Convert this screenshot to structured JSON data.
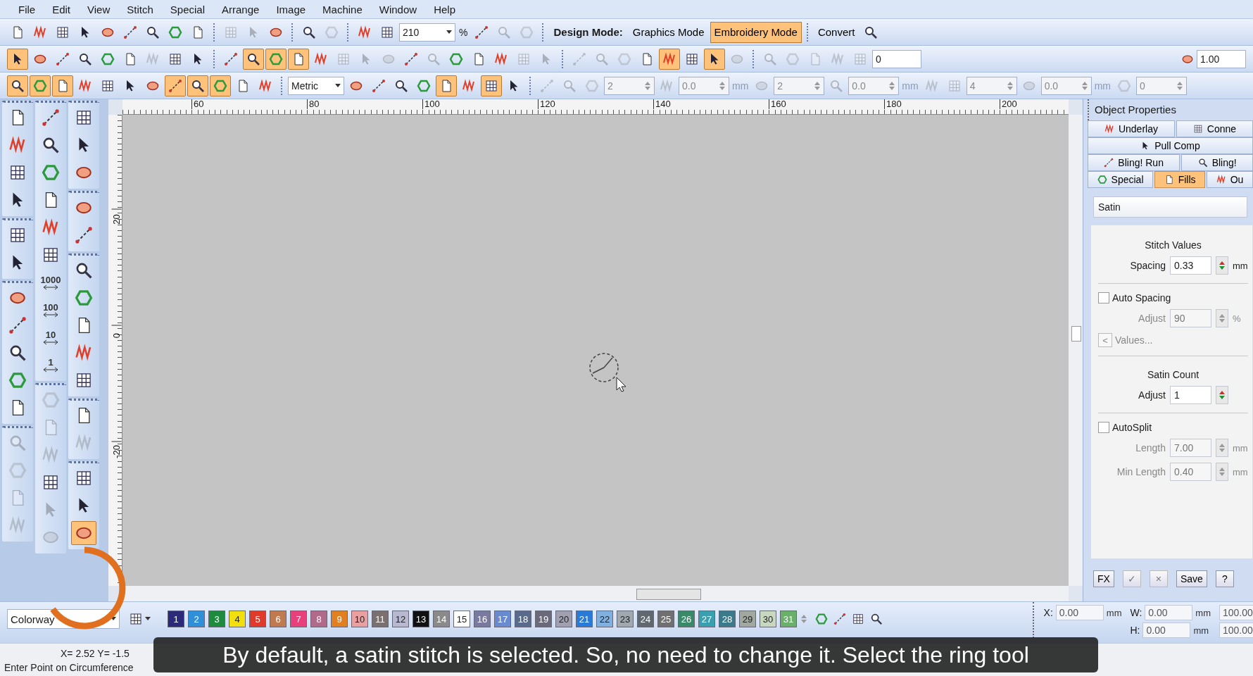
{
  "menu": [
    "File",
    "Edit",
    "View",
    "Stitch",
    "Special",
    "Arrange",
    "Image",
    "Machine",
    "Window",
    "Help"
  ],
  "toolbars": [
    {
      "items": [
        {
          "kind": "icon",
          "active": false,
          "disabled": false
        },
        {
          "kind": "icon",
          "active": false,
          "disabled": false
        },
        {
          "kind": "icon",
          "active": false,
          "disabled": false
        },
        {
          "kind": "icon",
          "active": false,
          "disabled": false
        },
        {
          "kind": "icon",
          "active": false,
          "disabled": false
        },
        {
          "kind": "icon",
          "active": false,
          "disabled": false
        },
        {
          "kind": "icon",
          "active": false,
          "disabled": false
        },
        {
          "kind": "icon",
          "active": false,
          "disabled": false
        },
        {
          "kind": "icon",
          "active": false,
          "disabled": false
        },
        {
          "kind": "sep"
        },
        {
          "kind": "icon",
          "active": false,
          "disabled": true
        },
        {
          "kind": "icon",
          "active": false,
          "disabled": true
        },
        {
          "kind": "icon",
          "active": false,
          "disabled": false
        },
        {
          "kind": "sep"
        },
        {
          "kind": "icon",
          "active": false,
          "disabled": false
        },
        {
          "kind": "icon",
          "active": false,
          "disabled": true
        },
        {
          "kind": "sep"
        },
        {
          "kind": "icon",
          "active": false,
          "disabled": false
        },
        {
          "kind": "icon",
          "active": false,
          "disabled": false
        },
        {
          "kind": "combo",
          "value": "210"
        },
        {
          "kind": "label",
          "label": "%"
        },
        {
          "kind": "icon",
          "active": false,
          "disabled": false
        },
        {
          "kind": "icon",
          "active": false,
          "disabled": true
        },
        {
          "kind": "icon",
          "active": false,
          "disabled": true
        },
        {
          "kind": "sep"
        },
        {
          "kind": "heading",
          "label": "Design Mode:"
        },
        {
          "kind": "mode",
          "label": "Graphics Mode",
          "selected": false
        },
        {
          "kind": "mode",
          "label": "Embroidery Mode",
          "selected": true
        },
        {
          "kind": "sep"
        },
        {
          "kind": "button",
          "label": "Convert"
        },
        {
          "kind": "icon",
          "active": false,
          "disabled": false
        }
      ]
    },
    {
      "items": [
        {
          "kind": "icon",
          "active": true,
          "disabled": false
        },
        {
          "kind": "icon",
          "active": false,
          "disabled": false
        },
        {
          "kind": "icon",
          "active": false,
          "disabled": false
        },
        {
          "kind": "icon",
          "active": false,
          "disabled": false
        },
        {
          "kind": "icon",
          "active": false,
          "disabled": false
        },
        {
          "kind": "icon",
          "active": false,
          "disabled": false
        },
        {
          "kind": "icon",
          "active": false,
          "disabled": true
        },
        {
          "kind": "icon",
          "active": false,
          "disabled": false
        },
        {
          "kind": "icon",
          "active": false,
          "disabled": false
        },
        {
          "kind": "sep"
        },
        {
          "kind": "icon",
          "active": false,
          "disabled": false
        },
        {
          "kind": "icon",
          "active": true,
          "disabled": false
        },
        {
          "kind": "icon",
          "active": true,
          "disabled": false
        },
        {
          "kind": "icon",
          "active": true,
          "disabled": false
        },
        {
          "kind": "icon",
          "active": false,
          "disabled": false
        },
        {
          "kind": "icon",
          "active": false,
          "disabled": true
        },
        {
          "kind": "icon",
          "active": false,
          "disabled": true
        },
        {
          "kind": "icon",
          "active": false,
          "disabled": true
        },
        {
          "kind": "icon",
          "active": false,
          "disabled": false
        },
        {
          "kind": "icon",
          "active": false,
          "disabled": true
        },
        {
          "kind": "icon",
          "active": false,
          "disabled": false
        },
        {
          "kind": "icon",
          "active": false,
          "disabled": false
        },
        {
          "kind": "icon",
          "active": false,
          "disabled": false
        },
        {
          "kind": "icon",
          "active": false,
          "disabled": true
        },
        {
          "kind": "icon",
          "active": false,
          "disabled": true
        },
        {
          "kind": "sep"
        },
        {
          "kind": "icon",
          "active": false,
          "disabled": true
        },
        {
          "kind": "icon",
          "active": false,
          "disabled": true
        },
        {
          "kind": "icon",
          "active": false,
          "disabled": true
        },
        {
          "kind": "icon",
          "active": false,
          "disabled": false
        },
        {
          "kind": "icon",
          "active": true,
          "disabled": false
        },
        {
          "kind": "icon",
          "active": false,
          "disabled": false
        },
        {
          "kind": "icon",
          "active": true,
          "disabled": false
        },
        {
          "kind": "icon",
          "active": false,
          "disabled": true
        },
        {
          "kind": "sep"
        },
        {
          "kind": "icon",
          "active": false,
          "disabled": true
        },
        {
          "kind": "icon",
          "active": false,
          "disabled": true
        },
        {
          "kind": "icon",
          "active": false,
          "disabled": true
        },
        {
          "kind": "icon",
          "active": false,
          "disabled": true
        },
        {
          "kind": "icon",
          "active": false,
          "disabled": true
        },
        {
          "kind": "field",
          "value": "0"
        },
        {
          "kind": "scale",
          "value": "1.00"
        }
      ]
    },
    {
      "items": [
        {
          "kind": "icon",
          "active": true,
          "disabled": false
        },
        {
          "kind": "icon",
          "active": true,
          "disabled": false
        },
        {
          "kind": "icon",
          "active": true,
          "disabled": false
        },
        {
          "kind": "icon",
          "active": false,
          "disabled": false
        },
        {
          "kind": "icon",
          "active": false,
          "disabled": false
        },
        {
          "kind": "icon",
          "active": false,
          "disabled": false
        },
        {
          "kind": "icon",
          "active": false,
          "disabled": false
        },
        {
          "kind": "icon",
          "active": true,
          "disabled": false
        },
        {
          "kind": "icon",
          "active": true,
          "disabled": false
        },
        {
          "kind": "icon",
          "active": true,
          "disabled": false
        },
        {
          "kind": "icon",
          "active": false,
          "disabled": false
        },
        {
          "kind": "icon",
          "active": false,
          "disabled": false
        },
        {
          "kind": "sep"
        },
        {
          "kind": "combo",
          "value": "Metric"
        },
        {
          "kind": "icon",
          "active": false,
          "disabled": false
        },
        {
          "kind": "icon",
          "active": false,
          "disabled": false
        },
        {
          "kind": "icon",
          "active": false,
          "disabled": false
        },
        {
          "kind": "icon",
          "active": false,
          "disabled": false
        },
        {
          "kind": "icon",
          "active": true,
          "disabled": false
        },
        {
          "kind": "icon",
          "active": false,
          "disabled": false
        },
        {
          "kind": "icon",
          "active": true,
          "disabled": false
        },
        {
          "kind": "icon",
          "active": false,
          "disabled": false
        },
        {
          "kind": "sep"
        },
        {
          "kind": "icon",
          "active": false,
          "disabled": true
        },
        {
          "kind": "icon",
          "active": false,
          "disabled": true
        },
        {
          "kind": "icon",
          "active": false,
          "disabled": true
        },
        {
          "kind": "spin",
          "value": "2"
        },
        {
          "kind": "icon",
          "active": false,
          "disabled": true
        },
        {
          "kind": "spin",
          "value": "0.0"
        },
        {
          "kind": "unit",
          "label": "mm"
        },
        {
          "kind": "icon",
          "active": false,
          "disabled": true
        },
        {
          "kind": "spin",
          "value": "2"
        },
        {
          "kind": "icon",
          "active": false,
          "disabled": true
        },
        {
          "kind": "spin",
          "value": "0.0"
        },
        {
          "kind": "unit",
          "label": "mm"
        },
        {
          "kind": "icon",
          "active": false,
          "disabled": true
        },
        {
          "kind": "icon",
          "active": false,
          "disabled": true
        },
        {
          "kind": "spin",
          "value": "4"
        },
        {
          "kind": "icon",
          "active": false,
          "disabled": true
        },
        {
          "kind": "spin",
          "value": "0.0"
        },
        {
          "kind": "unit",
          "label": "mm"
        },
        {
          "kind": "icon",
          "active": false,
          "disabled": true
        },
        {
          "kind": "spin",
          "value": "0"
        }
      ]
    }
  ],
  "toolbox": [
    {
      "groups": [
        [
          {
            "kind": "icon",
            "active": false,
            "disabled": false
          },
          {
            "kind": "icon",
            "active": false,
            "disabled": false
          },
          {
            "kind": "icon",
            "active": false,
            "disabled": false
          },
          {
            "kind": "icon",
            "active": false,
            "disabled": false
          }
        ],
        [
          {
            "kind": "icon",
            "active": false,
            "disabled": false
          },
          {
            "kind": "icon",
            "active": false,
            "disabled": false
          }
        ],
        [
          {
            "kind": "icon",
            "active": false,
            "disabled": false
          },
          {
            "kind": "icon",
            "active": false,
            "disabled": false
          },
          {
            "kind": "icon",
            "active": false,
            "disabled": false
          },
          {
            "kind": "icon",
            "active": false,
            "disabled": false
          },
          {
            "kind": "icon",
            "active": false,
            "disabled": false
          }
        ],
        [
          {
            "kind": "icon",
            "active": false,
            "disabled": true
          },
          {
            "kind": "icon",
            "active": false,
            "disabled": true
          },
          {
            "kind": "icon",
            "active": false,
            "disabled": true
          },
          {
            "kind": "icon",
            "active": false,
            "disabled": true
          }
        ]
      ]
    },
    {
      "groups": [
        [
          {
            "kind": "icon",
            "active": false,
            "disabled": false
          },
          {
            "kind": "icon",
            "active": false,
            "disabled": false
          },
          {
            "kind": "icon",
            "active": false,
            "disabled": false
          },
          {
            "kind": "icon",
            "active": false,
            "disabled": false
          },
          {
            "kind": "icon",
            "active": false,
            "disabled": false
          },
          {
            "kind": "icon",
            "active": false,
            "disabled": false
          },
          {
            "kind": "count",
            "label": "1000",
            "disabled": false
          },
          {
            "kind": "count",
            "label": "100",
            "disabled": false
          },
          {
            "kind": "count",
            "label": "10",
            "disabled": false
          },
          {
            "kind": "count",
            "label": "1",
            "disabled": false
          }
        ],
        [
          {
            "kind": "icon",
            "active": false,
            "disabled": true
          },
          {
            "kind": "icon",
            "active": false,
            "disabled": true
          },
          {
            "kind": "icon",
            "active": false,
            "disabled": true
          },
          {
            "kind": "icon",
            "active": false,
            "disabled": false
          },
          {
            "kind": "icon",
            "active": false,
            "disabled": true
          },
          {
            "kind": "icon",
            "active": false,
            "disabled": true
          }
        ]
      ]
    },
    {
      "groups": [
        [
          {
            "kind": "icon",
            "active": false,
            "disabled": false
          },
          {
            "kind": "icon",
            "active": false,
            "disabled": false
          },
          {
            "kind": "icon",
            "active": false,
            "disabled": false
          }
        ],
        [
          {
            "kind": "icon",
            "active": false,
            "disabled": false
          },
          {
            "kind": "icon",
            "active": false,
            "disabled": false
          }
        ],
        [
          {
            "kind": "icon",
            "active": false,
            "disabled": false
          },
          {
            "kind": "icon",
            "active": false,
            "disabled": false
          },
          {
            "kind": "icon",
            "active": false,
            "disabled": false
          },
          {
            "kind": "icon",
            "active": false,
            "disabled": false
          },
          {
            "kind": "icon",
            "active": false,
            "disabled": false
          }
        ],
        [
          {
            "kind": "icon",
            "active": false,
            "disabled": false
          },
          {
            "kind": "icon",
            "active": false,
            "disabled": true
          }
        ],
        [
          {
            "kind": "icon",
            "active": false,
            "disabled": false
          },
          {
            "kind": "icon",
            "active": false,
            "disabled": false
          },
          {
            "kind": "icon",
            "active": true,
            "disabled": false
          }
        ]
      ]
    }
  ],
  "ruler": {
    "x_labels": [
      "60",
      "80",
      "100",
      "120",
      "140",
      "160",
      "180",
      "200"
    ],
    "y_labels": [
      "20",
      "0",
      "-20"
    ]
  },
  "properties": {
    "title": "Object Properties",
    "tabs": [
      [
        {
          "label": "Underlay",
          "selected": false
        },
        {
          "label": "Conne",
          "selected": false
        }
      ],
      [
        {
          "label": "Pull Comp",
          "selected": false
        }
      ],
      [
        {
          "label": "Bling! Run",
          "selected": false
        },
        {
          "label": "Bling!",
          "selected": false
        }
      ],
      [
        {
          "label": "Special",
          "selected": false
        },
        {
          "label": "Fills",
          "selected": true
        },
        {
          "label": "Ou",
          "selected": false
        }
      ]
    ],
    "fill_type": "Satin",
    "settings": [
      {
        "kind": "heading",
        "label": "Stitch Values"
      },
      {
        "kind": "number",
        "label": "Spacing",
        "value": "0.33",
        "unit": "mm",
        "disabled": false
      },
      {
        "kind": "divider"
      },
      {
        "kind": "checkbox",
        "label": "Auto Spacing",
        "checked": false
      },
      {
        "kind": "number",
        "label": "Adjust",
        "value": "90",
        "unit": "%",
        "disabled": true
      },
      {
        "kind": "link",
        "arrow": "<",
        "label": "Values...",
        "disabled": true
      },
      {
        "kind": "divider"
      },
      {
        "kind": "heading",
        "label": "Satin Count"
      },
      {
        "kind": "number",
        "label": "Adjust",
        "value": "1",
        "disabled": false
      },
      {
        "kind": "divider"
      },
      {
        "kind": "checkbox",
        "label": "AutoSplit",
        "checked": false
      },
      {
        "kind": "number",
        "label": "Length",
        "value": "7.00",
        "unit": "mm",
        "disabled": true
      },
      {
        "kind": "number",
        "label": "Min Length",
        "value": "0.40",
        "unit": "mm",
        "disabled": true
      }
    ],
    "buttons": [
      {
        "label": "FX",
        "disabled": false
      },
      {
        "label": "✓",
        "disabled": true
      },
      {
        "label": "×",
        "disabled": true
      },
      {
        "label": "Save",
        "disabled": false
      },
      {
        "label": "?",
        "disabled": false
      }
    ]
  },
  "colorway": "Colorway",
  "colors": [
    {
      "label": "1",
      "color": "#2b2a78"
    },
    {
      "label": "2",
      "color": "#2f8fd8"
    },
    {
      "label": "3",
      "color": "#1e8a3e"
    },
    {
      "label": "4",
      "color": "#f2df10"
    },
    {
      "label": "5",
      "color": "#e03a2a"
    },
    {
      "label": "6",
      "color": "#c07a50"
    },
    {
      "label": "7",
      "color": "#e8407a"
    },
    {
      "label": "8",
      "color": "#b06a8a"
    },
    {
      "label": "9",
      "color": "#e08020"
    },
    {
      "label": "10",
      "color": "#eaa0a0"
    },
    {
      "label": "11",
      "color": "#7a7070"
    },
    {
      "label": "12",
      "color": "#b8b8d0"
    },
    {
      "label": "13",
      "color": "#111111"
    },
    {
      "label": "14",
      "color": "#8a8a8a"
    },
    {
      "label": "15",
      "color": "#ffffff"
    },
    {
      "label": "16",
      "color": "#7a7aa0"
    },
    {
      "label": "17",
      "color": "#6a8ad0"
    },
    {
      "label": "18",
      "color": "#5a6a8a"
    },
    {
      "label": "19",
      "color": "#6a6a7a"
    },
    {
      "label": "20",
      "color": "#a0a0b0"
    },
    {
      "label": "21",
      "color": "#2a7ad8"
    },
    {
      "label": "22",
      "color": "#80b0e0"
    },
    {
      "label": "23",
      "color": "#a0a8b0"
    },
    {
      "label": "24",
      "color": "#606870"
    },
    {
      "label": "25",
      "color": "#707070"
    },
    {
      "label": "26",
      "color": "#3a8a6a"
    },
    {
      "label": "27",
      "color": "#3aa0b0"
    },
    {
      "label": "28",
      "color": "#3a7a8a"
    },
    {
      "label": "29",
      "color": "#a0a8a0"
    },
    {
      "label": "30",
      "color": "#c8d8c0"
    },
    {
      "label": "31",
      "color": "#6ab06a"
    }
  ],
  "coords": [
    [
      {
        "label": "X:",
        "value": "0.00",
        "unit": "mm"
      },
      {
        "label": "W:",
        "value": "0.00",
        "unit": "mm"
      },
      {
        "value": "100.00"
      }
    ],
    [
      {
        "label": "H:",
        "value": "0.00",
        "unit": "mm"
      },
      {
        "value": "100.00"
      }
    ]
  ],
  "status": {
    "position": "X=  2.52 Y=  -1.5",
    "prompt": "Enter Point on Circumference"
  },
  "caption": "By default, a satin stitch is selected. So, no need to change it. Select the ring tool"
}
